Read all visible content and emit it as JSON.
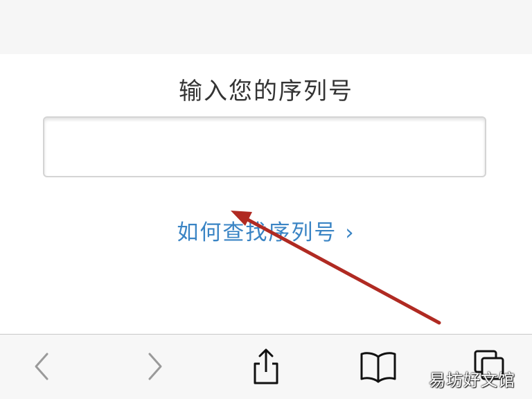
{
  "serial_form": {
    "title": "输入您的序列号",
    "input_value": "",
    "input_placeholder": "",
    "help_link": "如何查找序列号 ›"
  },
  "toolbar": {
    "back_icon": "chevron-left-icon",
    "forward_icon": "chevron-right-icon",
    "share_icon": "share-icon",
    "bookmarks_icon": "book-icon",
    "tabs_icon": "tabs-icon"
  },
  "colors": {
    "link": "#3a84c4",
    "arrow": "#b02a22",
    "toolbar_icon_disabled": "#9a9a9a",
    "toolbar_icon_active": "#111111"
  },
  "watermark": {
    "text": "易坊好文馆"
  }
}
